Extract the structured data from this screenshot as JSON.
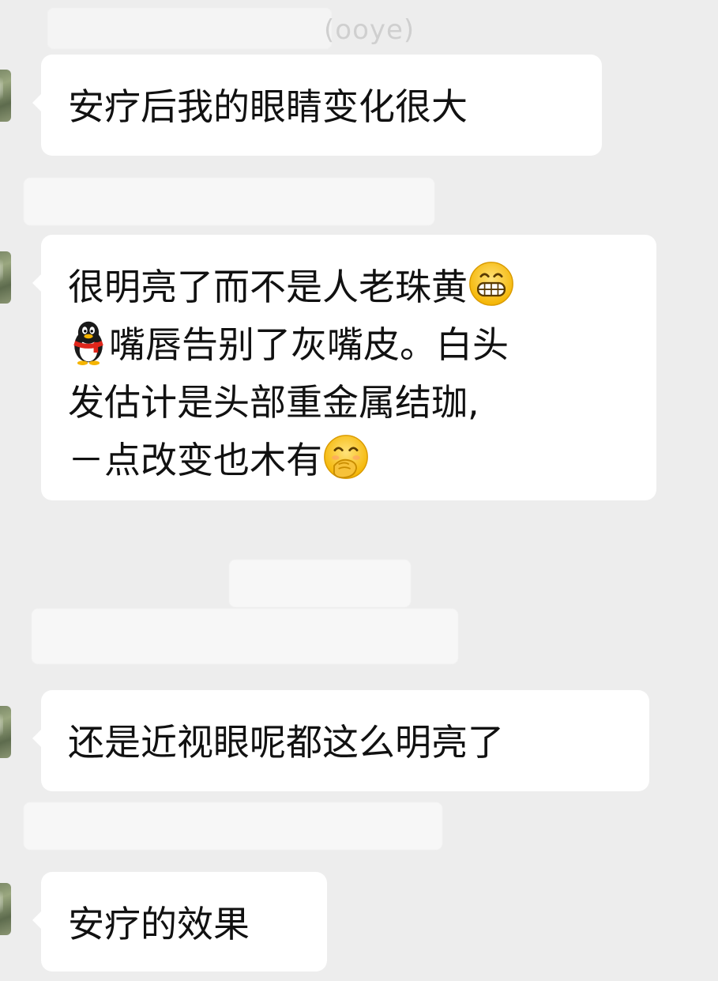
{
  "messages": [
    {
      "lines": [
        "安疗后我的眼睛变化很大"
      ]
    },
    {
      "line1": "很明亮了而不是人老珠黄",
      "line2": "嘴唇告别了灰嘴皮。白头",
      "line3": "发估计是头部重金属结珈,",
      "line4": "－点改变也木有",
      "emoji_after_line1": "grinning-face-icon",
      "emoji_before_line2": "qq-penguin-icon",
      "emoji_after_line4": "face-with-hand-over-mouth-icon"
    },
    {
      "lines": [
        "还是近视眼呢都这么明亮了"
      ]
    },
    {
      "lines": [
        "安疗的效果"
      ]
    }
  ],
  "faint_sender_name": "(ooye)",
  "colors": {
    "background": "#ededed",
    "bubble": "#ffffff",
    "text": "#111111"
  }
}
